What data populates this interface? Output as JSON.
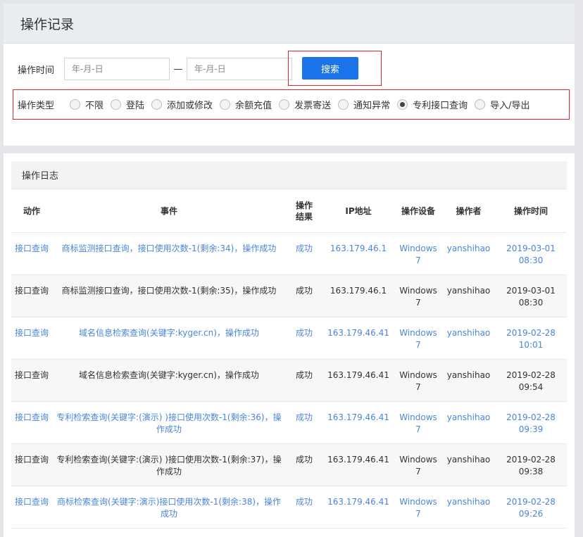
{
  "page": {
    "title": "操作记录"
  },
  "filter": {
    "time_label": "操作时间",
    "start_placeholder": "年-月-日",
    "end_placeholder": "年-月-日",
    "dash": "—",
    "search_label": "搜索",
    "type_label": "操作类型",
    "types": [
      {
        "label": "不限",
        "checked": false
      },
      {
        "label": "登陆",
        "checked": false
      },
      {
        "label": "添加或修改",
        "checked": false
      },
      {
        "label": "余额充值",
        "checked": false
      },
      {
        "label": "发票寄送",
        "checked": false
      },
      {
        "label": "通知异常",
        "checked": false
      },
      {
        "label": "专利接口查询",
        "checked": true
      },
      {
        "label": "导入/导出",
        "checked": false
      }
    ]
  },
  "log": {
    "title": "操作日志",
    "columns": [
      "动作",
      "事件",
      "操作结果",
      "IP地址",
      "操作设备",
      "操作者",
      "操作时间"
    ],
    "rows": [
      {
        "action": "接口查询",
        "event": "商标监测接口查询，接口使用次数-1(剩余:34)，操作成功",
        "result": "成功",
        "ip": "163.179.46.1",
        "device": "Windows 7",
        "user": "yanshihao",
        "time": "2019-03-01 08:30",
        "link": true
      },
      {
        "action": "接口查询",
        "event": "商标监测接口查询，接口使用次数-1(剩余:35)，操作成功",
        "result": "成功",
        "ip": "163.179.46.1",
        "device": "Windows 7",
        "user": "yanshihao",
        "time": "2019-03-01 08:30",
        "link": false
      },
      {
        "action": "接口查询",
        "event": "域名信息检索查询(关键字:kyger.cn)，操作成功",
        "result": "成功",
        "ip": "163.179.46.41",
        "device": "Windows 7",
        "user": "yanshihao",
        "time": "2019-02-28 10:01",
        "link": true
      },
      {
        "action": "接口查询",
        "event": "域名信息检索查询(关键字:kyger.cn)，操作成功",
        "result": "成功",
        "ip": "163.179.46.41",
        "device": "Windows 7",
        "user": "yanshihao",
        "time": "2019-02-28 09:54",
        "link": false
      },
      {
        "action": "接口查询",
        "event": "专利检索查询(关键字:(演示) )接口使用次数-1(剩余:36)，操作成功",
        "result": "成功",
        "ip": "163.179.46.41",
        "device": "Windows 7",
        "user": "yanshihao",
        "time": "2019-02-28 09:39",
        "link": true
      },
      {
        "action": "接口查询",
        "event": "专利检索查询(关键字:(演示) )接口使用次数-1(剩余:37)，操作成功",
        "result": "成功",
        "ip": "163.179.46.41",
        "device": "Windows 7",
        "user": "yanshihao",
        "time": "2019-02-28 09:38",
        "link": false
      },
      {
        "action": "接口查询",
        "event": "商标检索查询(关键字:演示)接口使用次数-1(剩余:38)，操作成功",
        "result": "成功",
        "ip": "163.179.46.41",
        "device": "Windows 7",
        "user": "yanshihao",
        "time": "2019-02-28 09:26",
        "link": true
      }
    ]
  }
}
